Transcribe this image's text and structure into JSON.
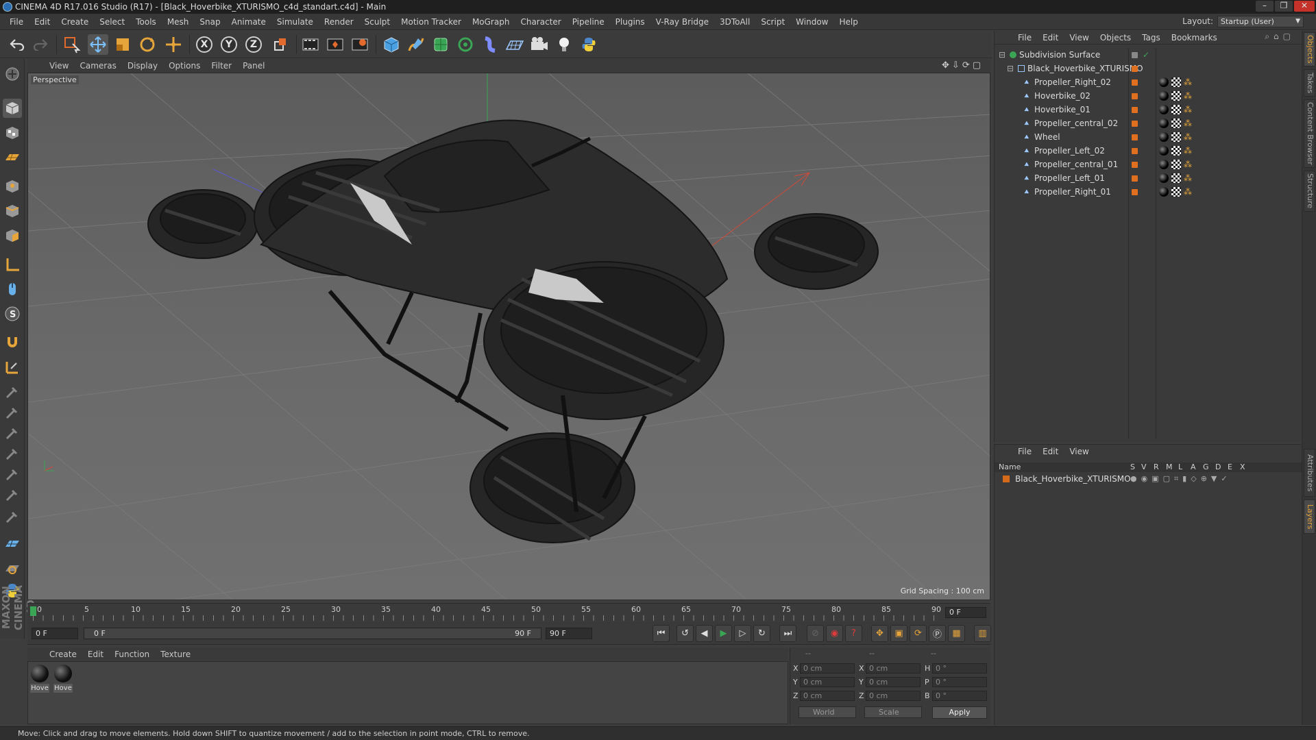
{
  "window": {
    "title": "CINEMA 4D R17.016 Studio (R17) - [Black_Hoverbike_XTURISMO_c4d_standart.c4d] - Main",
    "controls": [
      "–",
      "❐",
      "✕"
    ]
  },
  "menubar": {
    "items": [
      "File",
      "Edit",
      "Create",
      "Select",
      "Tools",
      "Mesh",
      "Snap",
      "Animate",
      "Simulate",
      "Render",
      "Sculpt",
      "Motion Tracker",
      "MoGraph",
      "Character",
      "Pipeline",
      "Plugins",
      "V-Ray Bridge",
      "3DToAll",
      "Script",
      "Window",
      "Help"
    ],
    "layout_label": "Layout:",
    "layout_value": "Startup (User)"
  },
  "toolbar": {
    "axis_x": "X",
    "axis_y": "Y",
    "axis_z": "Z"
  },
  "viewport": {
    "menu": [
      "View",
      "Cameras",
      "Display",
      "Options",
      "Filter",
      "Panel"
    ],
    "label": "Perspective",
    "grid_spacing": "Grid Spacing : 100 cm"
  },
  "timeline": {
    "ticks": [
      "0",
      "5",
      "10",
      "15",
      "20",
      "25",
      "30",
      "35",
      "40",
      "45",
      "50",
      "55",
      "60",
      "65",
      "70",
      "75",
      "80",
      "85",
      "90"
    ],
    "current_frame": "0 F"
  },
  "transport": {
    "start_field": "0 F",
    "range_start": "0 F",
    "range_end": "90 F",
    "end_field": "90 F"
  },
  "material_manager": {
    "menu": [
      "Create",
      "Edit",
      "Function",
      "Texture"
    ],
    "materials": [
      "Hove",
      "Hove"
    ]
  },
  "coordinates": {
    "headers": [
      "--",
      "--",
      "--"
    ],
    "rows": [
      {
        "l1": "X",
        "v1": "0 cm",
        "l2": "X",
        "v2": "0 cm",
        "l3": "H",
        "v3": "0 °"
      },
      {
        "l1": "Y",
        "v1": "0 cm",
        "l2": "Y",
        "v2": "0 cm",
        "l3": "P",
        "v3": "0 °"
      },
      {
        "l1": "Z",
        "v1": "0 cm",
        "l2": "Z",
        "v2": "0 cm",
        "l3": "B",
        "v3": "0 °"
      }
    ],
    "space": "World",
    "mode": "Scale",
    "apply": "Apply"
  },
  "object_manager": {
    "menu": [
      "File",
      "Edit",
      "View",
      "Objects",
      "Tags",
      "Bookmarks"
    ],
    "objects": [
      {
        "name": "Subdivision Surface"
      },
      {
        "name": "Black_Hoverbike_XTURISMO"
      },
      {
        "name": "Propeller_Right_02"
      },
      {
        "name": "Hoverbike_02"
      },
      {
        "name": "Hoverbike_01"
      },
      {
        "name": "Propeller_central_02"
      },
      {
        "name": "Wheel"
      },
      {
        "name": "Propeller_Left_02"
      },
      {
        "name": "Propeller_central_01"
      },
      {
        "name": "Propeller_Left_01"
      },
      {
        "name": "Propeller_Right_01"
      }
    ]
  },
  "layer_manager": {
    "menu": [
      "File",
      "Edit",
      "View"
    ],
    "columns": [
      "Name",
      "S",
      "V",
      "R",
      "M",
      "L",
      "A",
      "G",
      "D",
      "E",
      "X"
    ],
    "layer_name": "Black_Hoverbike_XTURISMO"
  },
  "right_tabs": [
    "Objects",
    "Takes",
    "Content Browser",
    "Structure",
    "Attributes",
    "Layers"
  ],
  "status": "Move: Click and drag to move elements. Hold down SHIFT to quantize movement / add to the selection in point mode, CTRL to remove.",
  "branding": "MAXON CINEMA 4D",
  "colors": {
    "accent": "#e8a43c",
    "object_tag": "#e0701f",
    "layer": "#d46a1a"
  }
}
